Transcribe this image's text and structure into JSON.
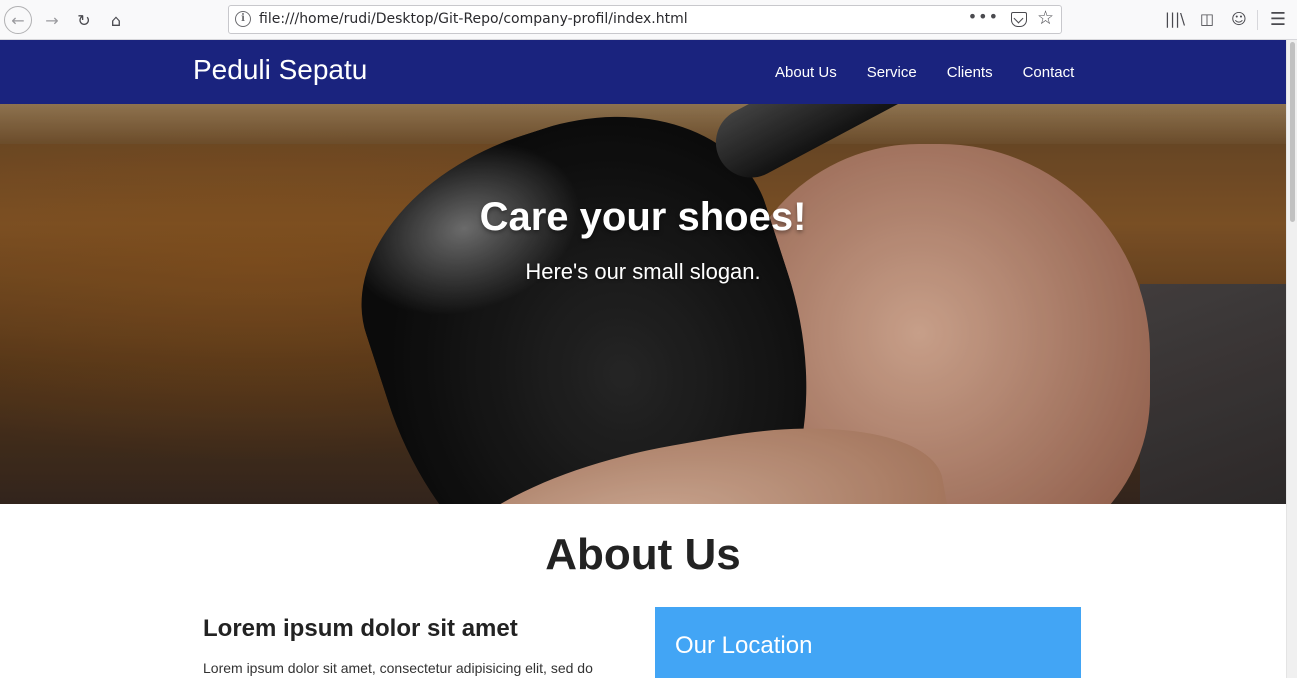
{
  "browser": {
    "url": "file:///home/rudi/Desktop/Git-Repo/company-profil/index.html",
    "more_label": "•••"
  },
  "site": {
    "brand": "Peduli Sepatu",
    "nav": [
      {
        "label": "About Us"
      },
      {
        "label": "Service"
      },
      {
        "label": "Clients"
      },
      {
        "label": "Contact"
      }
    ],
    "accent_color": "#1a237e"
  },
  "hero": {
    "title": "Care your shoes!",
    "slogan": "Here's our small slogan."
  },
  "about": {
    "title": "About Us",
    "subtitle": "Lorem ipsum dolor sit amet",
    "text": "Lorem ipsum dolor sit amet, consectetur adipisicing elit, sed do",
    "location_title": "Our Location",
    "location_color": "#42a5f5"
  }
}
